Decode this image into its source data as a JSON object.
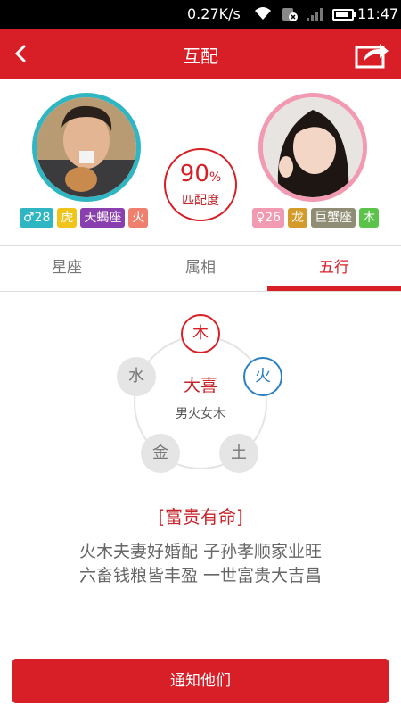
{
  "status_bar": {
    "speed": "0.27K/s",
    "time": "11:47"
  },
  "nav": {
    "title": "互配"
  },
  "colors": {
    "accent": "#d81e26",
    "male_ring": "#2fb6c2",
    "female_ring": "#f29ab1"
  },
  "match": {
    "percent": "90",
    "percent_sign": "%",
    "label": "匹配度"
  },
  "male": {
    "tags": [
      {
        "text": "♂28",
        "color": "#2fb6c2"
      },
      {
        "text": "虎",
        "color": "#f0c419"
      },
      {
        "text": "天蝎座",
        "color": "#8a3fae"
      },
      {
        "text": "火",
        "color": "#f0806e"
      }
    ]
  },
  "female": {
    "tags": [
      {
        "text": "♀26",
        "color": "#f29ab1"
      },
      {
        "text": "龙",
        "color": "#d49b2a"
      },
      {
        "text": "巨蟹座",
        "color": "#8f8d73"
      },
      {
        "text": "木",
        "color": "#5bc24a"
      }
    ]
  },
  "tabs": [
    {
      "label": "星座"
    },
    {
      "label": "属相"
    },
    {
      "label": "五行"
    }
  ],
  "elements": {
    "wood": "木",
    "fire": "火",
    "water": "水",
    "metal": "金",
    "earth": "土",
    "center_title": "大喜",
    "center_sub": "男火女木"
  },
  "fortune": {
    "title": "[富贵有命]",
    "line1": "火木夫妻好婚配 子孙孝顺家业旺",
    "line2": "六畜钱粮皆丰盈 一世富贵大吉昌"
  },
  "actions": {
    "notify_label": "通知他们"
  }
}
